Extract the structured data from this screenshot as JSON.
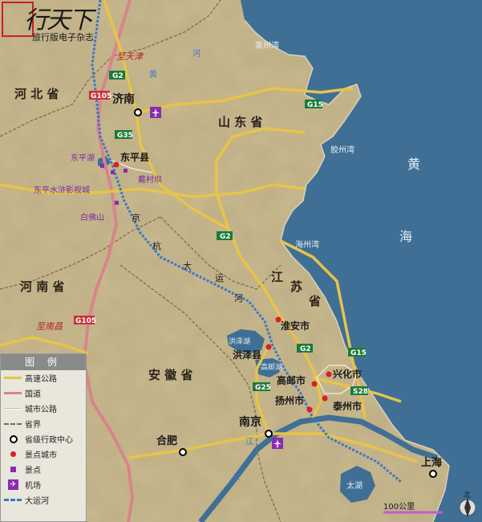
{
  "logo": {
    "mark": "行天下",
    "subtitle": "旅行版电子杂志"
  },
  "legend": {
    "title": "图 例",
    "items": [
      {
        "label": "高速公路",
        "symbol": "expressway"
      },
      {
        "label": "国道",
        "symbol": "national-road"
      },
      {
        "label": "城市公路",
        "symbol": "city-road"
      },
      {
        "label": "省界",
        "symbol": "province-border"
      },
      {
        "label": "省级行政中心",
        "symbol": "provincial-capital"
      },
      {
        "label": "景点城市",
        "symbol": "scenic-city"
      },
      {
        "label": "景点",
        "symbol": "scenic-spot"
      },
      {
        "label": "机场",
        "symbol": "airport"
      },
      {
        "label": "大运河",
        "symbol": "grand-canal"
      }
    ]
  },
  "provinces": [
    {
      "name": "河北省",
      "label": "河 北 省"
    },
    {
      "name": "山东省",
      "label": "山 东 省"
    },
    {
      "name": "河南省",
      "label": "河 南 省"
    },
    {
      "name": "安徽省",
      "label": "安 徽 省"
    },
    {
      "name": "江苏省-jiang",
      "label": "江"
    },
    {
      "name": "江苏省-su",
      "label": "苏"
    },
    {
      "name": "江苏省-sheng",
      "label": "省"
    }
  ],
  "cities": {
    "jinan": "济南",
    "dongping": "东平县",
    "huaian": "淮安市",
    "hongze": "洪泽县",
    "gaoyou": "高邮市",
    "yangzhou": "扬州市",
    "xinghua": "兴化市",
    "taizhou": "泰州市",
    "nanjing": "南京",
    "hefei": "合肥",
    "shanghai": "上海"
  },
  "spots": {
    "dongpinghu": "东平湖",
    "daicunba": "戴村坝",
    "shuihu": "东平水浒影视城",
    "baifoshan": "白佛山"
  },
  "directions": {
    "tianjin": "至天津",
    "nanchang": "至南昌"
  },
  "water": {
    "laizhouwan": "莱州湾",
    "jiaozhouwan": "胶州湾",
    "haizhouwan": "海州湾",
    "huang": "黄",
    "hai": "海",
    "hongzehu": "洪泽湖",
    "gaoyouhu": "高邮湖",
    "taihu": "太湖",
    "he": "河",
    "huang2": "黄",
    "chang": "长",
    "jiang": "江"
  },
  "canal_chars": [
    "京",
    "杭",
    "大",
    "运",
    "河"
  ],
  "road_shields": {
    "g2_north": "G2",
    "g105_north": "G105",
    "g15_north": "G15",
    "g35": "G35",
    "g2_mid": "G2",
    "g105_south": "G105",
    "g2_south": "G2",
    "g15_south": "G15",
    "s28": "S28",
    "g25": "G25"
  },
  "scale": {
    "label": "100公里"
  },
  "compass": {
    "label": "北"
  },
  "colors": {
    "sea": "#3f6f95",
    "land": "#c9b98e",
    "expressway": "#e6c44a",
    "national": "#d8848c",
    "canal": "#3a78c8",
    "spot": "#8b2bb0",
    "city": "#d81e2a"
  }
}
